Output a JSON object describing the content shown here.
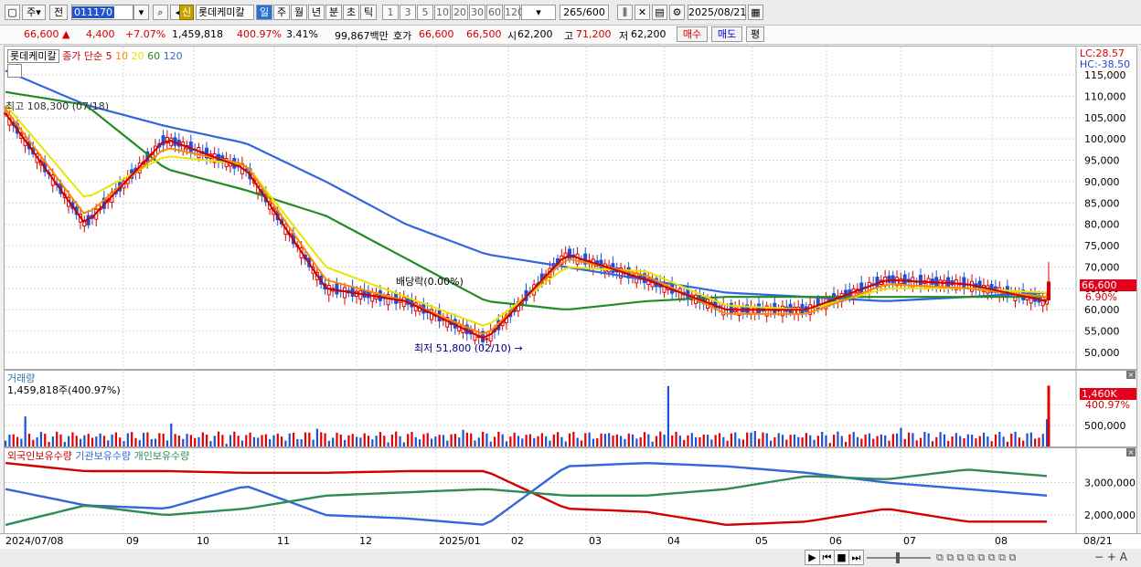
{
  "toolbar": {
    "market": "주",
    "prev": "전",
    "code": "011170",
    "stock_name": "롯데케미칼",
    "periods": [
      "일",
      "주",
      "월",
      "년",
      "분",
      "초",
      "틱"
    ],
    "active_period": "일",
    "intervals": [
      "1",
      "3",
      "5",
      "10",
      "20",
      "30",
      "60",
      "120"
    ],
    "count": "265",
    "count_total": "/600",
    "date": "2025/08/21",
    "new_badge": "신"
  },
  "quote": {
    "price": "66,600",
    "change": "4,400",
    "change_pct": "+7.07%",
    "volume": "1,459,818",
    "volume_ratio": "400.97%",
    "turnover_pct": "3.41%",
    "amount": "99,867백만",
    "ask_label": "호가",
    "ask": "66,600",
    "bid": "66,500",
    "open_label": "시",
    "open": "62,200",
    "high_label": "고",
    "high": "71,200",
    "low_label": "저",
    "low": "62,200",
    "buy": "매수",
    "sell": "매도",
    "eval": "평"
  },
  "legend": {
    "name": "롯데케미칼",
    "ma_label": "종가 단순",
    "ma_periods": [
      "5",
      "10",
      "20",
      "60",
      "120"
    ],
    "colors": [
      "#cc0000",
      "#ff8800",
      "#e6e600",
      "#228b22",
      "#3366dd"
    ]
  },
  "annotations": {
    "high_note": "최고 108,300 (07/18)",
    "dividend": "배당락(0.00%)",
    "low_note": "최저 51,800 (02/10)",
    "lc": "LC:28.57",
    "hc": "HC:-38.50",
    "current_price": "66,600",
    "current_pct": "6.90%"
  },
  "volume_panel": {
    "title": "거래량",
    "value": "1,459,818주(400.97%)",
    "current": "1,460K",
    "current_pct": "400.97%"
  },
  "holdings_panel": {
    "foreign": "외국인보유수량",
    "institution": "기관보유수량",
    "individual": "개인보유수량"
  },
  "x_labels": [
    "2024/07/08",
    "09",
    "10",
    "11",
    "12",
    "2025/01",
    "02",
    "03",
    "04",
    "05",
    "06",
    "07",
    "08",
    "08/21"
  ],
  "chart_data": [
    {
      "type": "line",
      "title": "롯데케미칼 일봉 (종가 단순 이동평균)",
      "ylim": [
        47000,
        118000
      ],
      "yticks": [
        50000,
        55000,
        60000,
        65000,
        70000,
        75000,
        80000,
        85000,
        90000,
        95000,
        100000,
        105000,
        110000,
        115000
      ],
      "x": [
        "2024/07/08",
        "2024/09",
        "2024/10",
        "2024/11",
        "2024/12",
        "2025/01",
        "2025/02",
        "2025/03",
        "2025/04",
        "2025/05",
        "2025/06",
        "2025/07",
        "2025/08",
        "2025/08/21"
      ],
      "series": [
        {
          "name": "5",
          "values": [
            106000,
            80000,
            100000,
            93000,
            65000,
            62000,
            53000,
            73000,
            67000,
            60000,
            60000,
            67000,
            66000,
            62000
          ]
        },
        {
          "name": "10",
          "values": [
            107000,
            82000,
            98000,
            94000,
            67000,
            62000,
            54000,
            72000,
            68000,
            59000,
            59000,
            66000,
            65000,
            63000
          ]
        },
        {
          "name": "20",
          "values": [
            108000,
            86000,
            96000,
            94000,
            70000,
            63000,
            56000,
            70000,
            69000,
            61000,
            60000,
            65000,
            65000,
            64000
          ]
        },
        {
          "name": "60",
          "values": [
            111000,
            108000,
            93000,
            88000,
            82000,
            72000,
            62000,
            60000,
            62000,
            63000,
            63000,
            63000,
            63000,
            63000
          ]
        },
        {
          "name": "120",
          "values": [
            116000,
            108000,
            103000,
            99000,
            90000,
            80000,
            73000,
            70000,
            67000,
            64000,
            63000,
            62000,
            63000,
            64000
          ]
        }
      ],
      "candles": {
        "last": {
          "open": 62200,
          "high": 71200,
          "low": 62200,
          "close": 66600
        },
        "high": {
          "value": 108300,
          "date": "07/18"
        },
        "low": {
          "value": 51800,
          "date": "02/10"
        }
      }
    },
    {
      "type": "bar",
      "title": "거래량",
      "ylim": [
        0,
        1600000
      ],
      "yticks": [
        500000,
        1000000
      ],
      "last_value": 1459818
    },
    {
      "type": "line",
      "title": "보유수량",
      "ylim": [
        1500000,
        3800000
      ],
      "yticks": [
        2000000,
        3000000
      ],
      "series": [
        {
          "name": "외국인보유수량",
          "values": [
            3600000,
            3350000,
            3350000,
            3300000,
            3300000,
            3350000,
            3350000,
            2200000,
            2100000,
            1700000,
            1800000,
            2200000,
            1800000,
            1800000
          ]
        },
        {
          "name": "기관보유수량",
          "values": [
            2800000,
            2300000,
            2200000,
            2900000,
            2000000,
            1900000,
            1700000,
            3500000,
            3600000,
            3500000,
            3300000,
            3000000,
            2800000,
            2600000
          ]
        },
        {
          "name": "개인보유수량",
          "values": [
            1700000,
            2300000,
            2000000,
            2200000,
            2600000,
            2700000,
            2800000,
            2600000,
            2600000,
            2800000,
            3200000,
            3100000,
            3400000,
            3200000
          ]
        }
      ]
    }
  ]
}
